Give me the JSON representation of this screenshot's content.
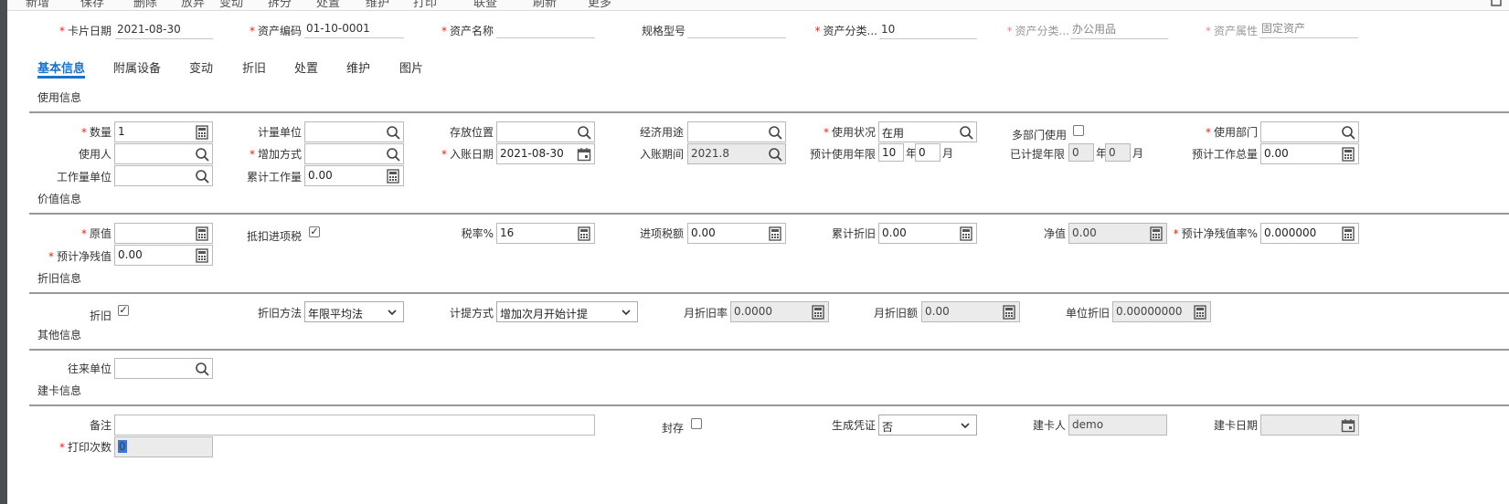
{
  "toolbar": {
    "items": [
      "新增",
      "保存",
      "删除",
      "放弃",
      "变动",
      "拆分",
      "处置",
      "维护",
      "打印",
      "联查",
      "刷新",
      "更多"
    ]
  },
  "header": {
    "card_date_label": "卡片日期",
    "card_date": "2021-08-30",
    "asset_code_label": "资产编码",
    "asset_code": "01-10-0001",
    "asset_name_label": "资产名称",
    "asset_name": "",
    "spec_label": "规格型号",
    "spec": "",
    "category_code_label": "资产分类...",
    "category_code": "10",
    "category_name_label": "资产分类...",
    "category_name": "办公用品",
    "attribute_label": "资产属性",
    "attribute": "固定资产"
  },
  "tabs": [
    "基本信息",
    "附属设备",
    "变动",
    "折旧",
    "处置",
    "维护",
    "图片"
  ],
  "sections": {
    "usage": "使用信息",
    "value": "价值信息",
    "depreciation": "折旧信息",
    "other": "其他信息",
    "creation": "建卡信息"
  },
  "usage": {
    "quantity_label": "数量",
    "quantity": "1",
    "unit_label": "计量单位",
    "unit": "",
    "location_label": "存放位置",
    "location": "",
    "purpose_label": "经济用途",
    "purpose": "",
    "status_label": "使用状况",
    "status": "在用",
    "multi_dept_label": "多部门使用",
    "dept_label": "使用部门",
    "dept": "",
    "user_label": "使用人",
    "user": "",
    "add_method_label": "增加方式",
    "add_method": "",
    "entry_date_label": "入账日期",
    "entry_date": "2021-08-30",
    "entry_period_label": "入账期间",
    "entry_period": "2021.8",
    "life_label": "预计使用年限",
    "life_years": "10",
    "life_months": "0",
    "year_unit": "年",
    "month_unit": "月",
    "accrued_label": "已计提年限",
    "accrued_years": "0",
    "accrued_months": "0",
    "total_work_label": "预计工作总量",
    "total_work": "0.00",
    "work_unit_label": "工作量单位",
    "work_unit": "",
    "cum_work_label": "累计工作量",
    "cum_work": "0.00"
  },
  "value": {
    "original_label": "原值",
    "original": "",
    "deduct_label": "抵扣进项税",
    "tax_rate_label": "税率%",
    "tax_rate": "16",
    "input_tax_label": "进项税额",
    "input_tax": "0.00",
    "cum_dep_label": "累计折旧",
    "cum_dep": "0.00",
    "net_label": "净值",
    "net": "0.00",
    "residual_rate_label": "预计净残值率%",
    "residual_rate": "0.000000",
    "residual_label": "预计净残值",
    "residual": "0.00"
  },
  "depreciation": {
    "dep_label": "折旧",
    "method_label": "折旧方法",
    "method": "年限平均法",
    "accrual_label": "计提方式",
    "accrual": "增加次月开始计提",
    "monthly_rate_label": "月折旧率",
    "monthly_rate": "0.0000",
    "monthly_amount_label": "月折旧额",
    "monthly_amount": "0.00",
    "unit_dep_label": "单位折旧",
    "unit_dep": "0.00000000"
  },
  "other": {
    "partner_label": "往来单位",
    "partner": ""
  },
  "creation": {
    "remark_label": "备注",
    "remark": "",
    "seal_label": "封存",
    "voucher_label": "生成凭证",
    "voucher": "否",
    "creator_label": "建卡人",
    "creator": "demo",
    "create_date_label": "建卡日期",
    "create_date": "",
    "print_count_label": "打印次数",
    "print_count": "0"
  }
}
